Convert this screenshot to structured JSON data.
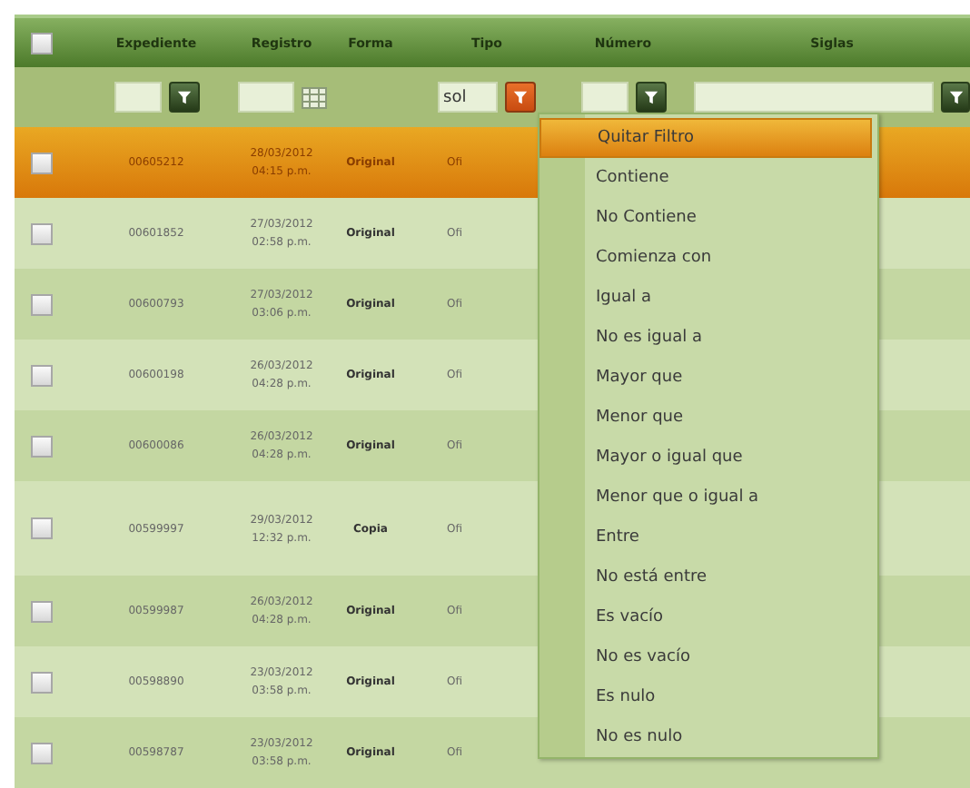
{
  "table": {
    "header_checkbox": {
      "checked": false
    },
    "columns": [
      "Expediente",
      "Registro",
      "Forma",
      "Tipo",
      "Número",
      "Siglas"
    ],
    "filters": [
      {
        "kind": "empty"
      },
      {
        "kind": "text",
        "button_active": false
      },
      {
        "kind": "date"
      },
      {
        "kind": "empty"
      },
      {
        "kind": "text",
        "value": "sol",
        "button_active": true
      },
      {
        "kind": "text",
        "button_active": false
      },
      {
        "kind": "text",
        "button_active": false
      }
    ],
    "rows": [
      {
        "selected": true,
        "checked": false,
        "expediente": "00605212",
        "date": "28/03/2012",
        "time": "04:15 p.m.",
        "forma": "Original",
        "tipo": "Ofi"
      },
      {
        "selected": false,
        "checked": false,
        "expediente": "00601852",
        "date": "27/03/2012",
        "time": "02:58 p.m.",
        "forma": "Original",
        "tipo": "Ofi"
      },
      {
        "selected": false,
        "checked": false,
        "expediente": "00600793",
        "date": "27/03/2012",
        "time": "03:06 p.m.",
        "forma": "Original",
        "tipo": "Ofi"
      },
      {
        "selected": false,
        "checked": false,
        "expediente": "00600198",
        "date": "26/03/2012",
        "time": "04:28 p.m.",
        "forma": "Original",
        "tipo": "Ofi"
      },
      {
        "selected": false,
        "checked": false,
        "expediente": "00600086",
        "date": "26/03/2012",
        "time": "04:28 p.m.",
        "forma": "Original",
        "tipo": "Ofi"
      },
      {
        "selected": false,
        "checked": false,
        "expediente": "00599997",
        "date": "29/03/2012",
        "time": "12:32 p.m.",
        "forma": "Copia",
        "tipo": "Ofi"
      },
      {
        "selected": false,
        "checked": false,
        "expediente": "00599987",
        "date": "26/03/2012",
        "time": "04:28 p.m.",
        "forma": "Original",
        "tipo": "Ofi"
      },
      {
        "selected": false,
        "checked": false,
        "expediente": "00598890",
        "date": "23/03/2012",
        "time": "03:58 p.m.",
        "forma": "Original",
        "tipo": "Ofi"
      },
      {
        "selected": false,
        "checked": false,
        "expediente": "00598787",
        "date": "23/03/2012",
        "time": "03:58 p.m.",
        "forma": "Original",
        "tipo": "Ofi"
      }
    ]
  },
  "filter_menu": {
    "items": [
      {
        "label": "Quitar Filtro",
        "selected": true
      },
      {
        "label": "Contiene",
        "selected": false
      },
      {
        "label": "No Contiene",
        "selected": false
      },
      {
        "label": "Comienza con",
        "selected": false
      },
      {
        "label": "Igual a",
        "selected": false
      },
      {
        "label": "No es igual a",
        "selected": false
      },
      {
        "label": "Mayor que",
        "selected": false
      },
      {
        "label": "Menor que",
        "selected": false
      },
      {
        "label": "Mayor o igual que",
        "selected": false
      },
      {
        "label": "Menor que o igual a",
        "selected": false
      },
      {
        "label": "Entre",
        "selected": false
      },
      {
        "label": "No está entre",
        "selected": false
      },
      {
        "label": "Es vacío",
        "selected": false
      },
      {
        "label": "No es vacío",
        "selected": false
      },
      {
        "label": "Es nulo",
        "selected": false
      },
      {
        "label": "No es nulo",
        "selected": false
      }
    ]
  }
}
